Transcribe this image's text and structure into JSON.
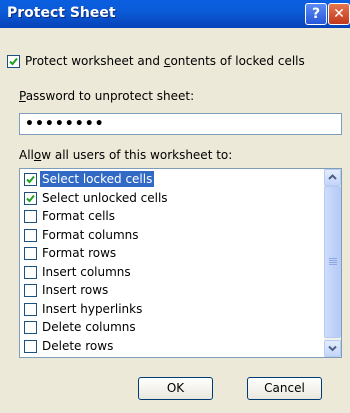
{
  "dialog": {
    "title": "Protect Sheet",
    "help_glyph": "?",
    "close_glyph": "✕"
  },
  "protect_option": {
    "label_pre": "Protect worksheet and ",
    "label_underlined": "c",
    "label_post": "ontents of locked cells",
    "checked": true
  },
  "password": {
    "label_underlined": "P",
    "label_post": "assword to unprotect sheet:",
    "value": "••••••••"
  },
  "allow": {
    "label_pre": "All",
    "label_underlined": "o",
    "label_post": "w all users of this worksheet to:"
  },
  "permissions": [
    {
      "label": "Select locked cells",
      "checked": true,
      "selected": true
    },
    {
      "label": "Select unlocked cells",
      "checked": true,
      "selected": false
    },
    {
      "label": "Format cells",
      "checked": false,
      "selected": false
    },
    {
      "label": "Format columns",
      "checked": false,
      "selected": false
    },
    {
      "label": "Format rows",
      "checked": false,
      "selected": false
    },
    {
      "label": "Insert columns",
      "checked": false,
      "selected": false
    },
    {
      "label": "Insert rows",
      "checked": false,
      "selected": false
    },
    {
      "label": "Insert hyperlinks",
      "checked": false,
      "selected": false
    },
    {
      "label": "Delete columns",
      "checked": false,
      "selected": false
    },
    {
      "label": "Delete rows",
      "checked": false,
      "selected": false
    }
  ],
  "buttons": {
    "ok": "OK",
    "cancel": "Cancel"
  },
  "colors": {
    "titlebar": "#0A5FE0",
    "dialog_bg": "#ECE9D8",
    "selection": "#316AC5",
    "checkmark": "#21A121"
  }
}
